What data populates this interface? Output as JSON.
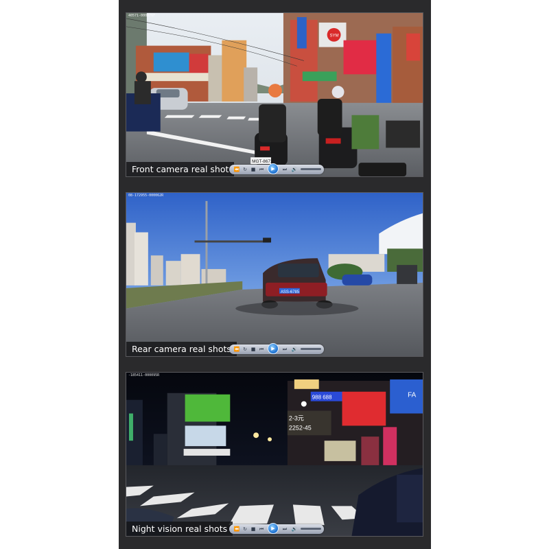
{
  "panels": [
    {
      "id": "front",
      "caption": "Front camera real shot",
      "timestamp": "40571-000076F",
      "plate": "MGT-8673"
    },
    {
      "id": "rear",
      "caption": "Rear camera real shots",
      "timestamp": "08-172955-000062R",
      "plate": "ASS-6785"
    },
    {
      "id": "night",
      "caption": "Night vision real shots",
      "timestamp": "-185411-000095R",
      "plate": ""
    }
  ],
  "player_controls": [
    "rewind-icon",
    "refresh-icon",
    "stop-icon",
    "prev-icon",
    "play-icon",
    "next-icon",
    "fast-forward-icon",
    "volume-icon"
  ],
  "signs": {
    "sym": "SYM",
    "night_price": "2-3元",
    "night_phone": "2252-45",
    "night_ad": "FA",
    "night_sign2": "988 688"
  },
  "colors": {
    "frame": "#2a2a2c",
    "caption_bg": "#141416",
    "play": "#1b6fd0"
  }
}
